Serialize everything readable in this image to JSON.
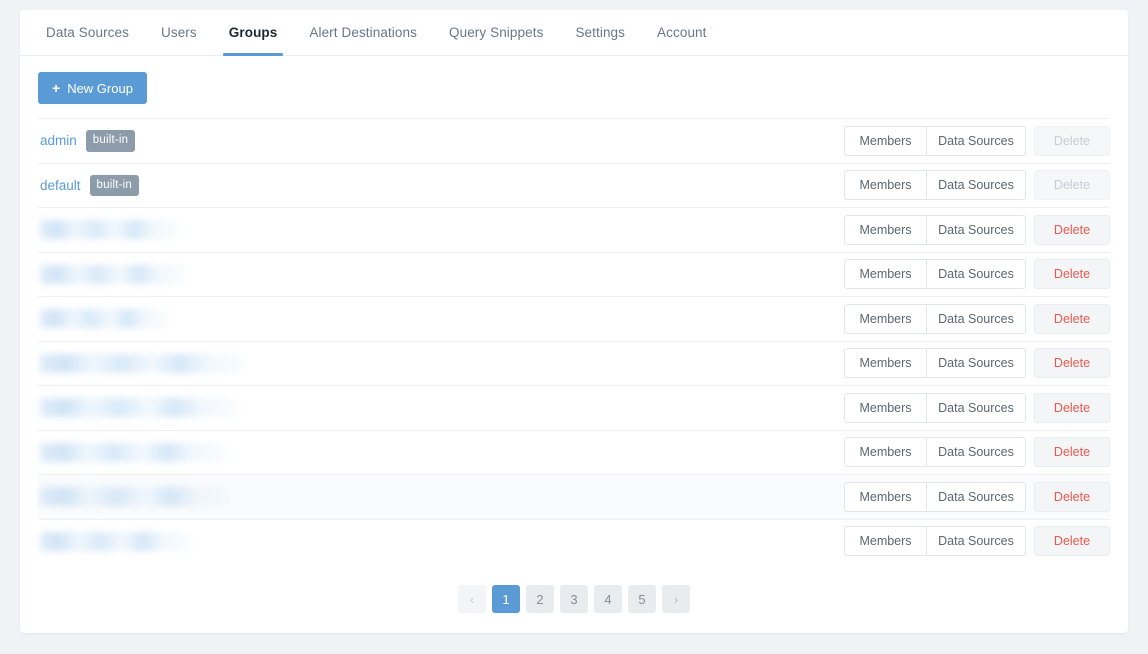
{
  "tabs": [
    {
      "label": "Data Sources",
      "active": false
    },
    {
      "label": "Users",
      "active": false
    },
    {
      "label": "Groups",
      "active": true
    },
    {
      "label": "Alert Destinations",
      "active": false
    },
    {
      "label": "Query Snippets",
      "active": false
    },
    {
      "label": "Settings",
      "active": false
    },
    {
      "label": "Account",
      "active": false
    }
  ],
  "toolbar": {
    "new_group_label": "New Group",
    "new_group_icon": "plus-icon"
  },
  "table": {
    "buttons": {
      "members": "Members",
      "data_sources": "Data Sources",
      "delete": "Delete"
    },
    "badge_builtin": "built-in",
    "rows": [
      {
        "name": "admin",
        "redacted": false,
        "builtin": true,
        "delete_enabled": false,
        "hovered": false,
        "redacted_width": 0
      },
      {
        "name": "default",
        "redacted": false,
        "builtin": true,
        "delete_enabled": false,
        "hovered": false,
        "redacted_width": 0
      },
      {
        "name": "",
        "redacted": true,
        "builtin": false,
        "delete_enabled": true,
        "hovered": false,
        "redacted_width": 138
      },
      {
        "name": "",
        "redacted": true,
        "builtin": false,
        "delete_enabled": true,
        "hovered": false,
        "redacted_width": 145
      },
      {
        "name": "",
        "redacted": true,
        "builtin": false,
        "delete_enabled": true,
        "hovered": false,
        "redacted_width": 128
      },
      {
        "name": "",
        "redacted": true,
        "builtin": false,
        "delete_enabled": true,
        "hovered": false,
        "redacted_width": 205
      },
      {
        "name": "",
        "redacted": true,
        "builtin": false,
        "delete_enabled": true,
        "hovered": false,
        "redacted_width": 198
      },
      {
        "name": "",
        "redacted": true,
        "builtin": false,
        "delete_enabled": true,
        "hovered": false,
        "redacted_width": 186
      },
      {
        "name": "",
        "redacted": true,
        "builtin": false,
        "delete_enabled": true,
        "hovered": true,
        "redacted_width": 192
      },
      {
        "name": "",
        "redacted": true,
        "builtin": false,
        "delete_enabled": true,
        "hovered": false,
        "redacted_width": 150
      }
    ]
  },
  "pagination": {
    "prev_label": "‹",
    "next_label": "›",
    "prev_disabled": true,
    "next_disabled": false,
    "pages": [
      "1",
      "2",
      "3",
      "4",
      "5"
    ],
    "current_page": "1"
  },
  "colors": {
    "accent": "#5b9bd5",
    "page_background": "#f0f2f5",
    "card_background": "#ffffff",
    "delete_red": "#e8594f",
    "badge_slate": "#8c9cab",
    "muted_text": "#6b7785"
  }
}
